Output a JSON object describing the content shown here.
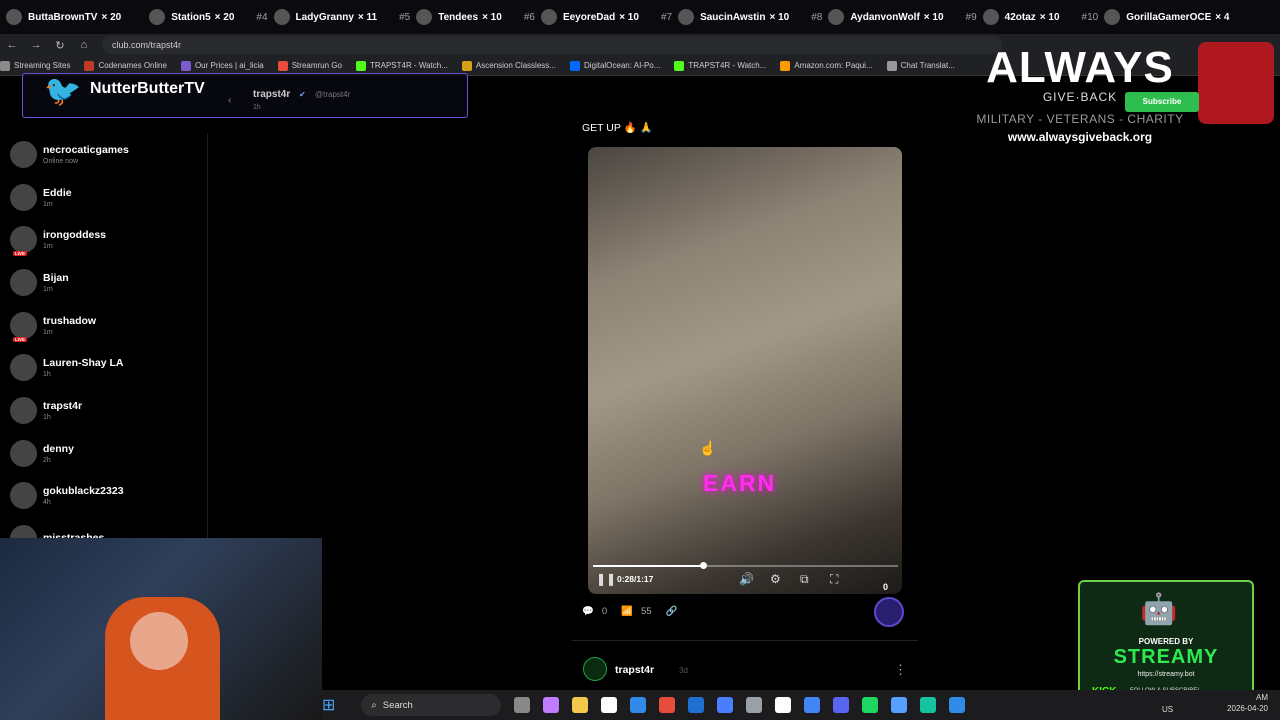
{
  "ticker": [
    {
      "rank": "",
      "name": "ButtaBrownTV",
      "mult": "× 20"
    },
    {
      "rank": "",
      "name": "Station5",
      "mult": "× 20"
    },
    {
      "rank": "#4",
      "name": "LadyGranny",
      "mult": "× 11"
    },
    {
      "rank": "#5",
      "name": "Tendees",
      "mult": "× 10"
    },
    {
      "rank": "#6",
      "name": "EeyoreDad",
      "mult": "× 10"
    },
    {
      "rank": "#7",
      "name": "SaucinAwstin",
      "mult": "× 10"
    },
    {
      "rank": "#8",
      "name": "AydanvonWolf",
      "mult": "× 10"
    },
    {
      "rank": "#9",
      "name": "42otaz",
      "mult": "× 10"
    },
    {
      "rank": "#10",
      "name": "GorillaGamerOCE",
      "mult": "× 4"
    }
  ],
  "browser": {
    "url": "club.com/trapst4r",
    "bookmarks": [
      {
        "label": "Streaming Sites",
        "color": "#8a8a8a"
      },
      {
        "label": "Codenames Online",
        "color": "#c0392b"
      },
      {
        "label": "Our Prices | ai_licia",
        "color": "#7d5ccf"
      },
      {
        "label": "Streamrun Go",
        "color": "#e74c3c"
      },
      {
        "label": "TRAPST4R - Watch...",
        "color": "#53fc18"
      },
      {
        "label": "Ascension Classless...",
        "color": "#d4a017"
      },
      {
        "label": "DigitalOcean: AI-Po...",
        "color": "#0069ff"
      },
      {
        "label": "TRAPST4R - Watch...",
        "color": "#53fc18"
      },
      {
        "label": "Amazon.com: Paqui...",
        "color": "#ff9900"
      },
      {
        "label": "Chat Translat...",
        "color": "#999999"
      }
    ]
  },
  "popup": {
    "twitter_name": "NutterButterTV",
    "poster": "trapst4r",
    "handle": "@trapst4r",
    "time": "1h"
  },
  "sidebar": {
    "items": [
      {
        "name": "necrocaticgames",
        "time": "Online now",
        "live": false
      },
      {
        "name": "Eddie",
        "time": "1m",
        "live": false
      },
      {
        "name": "irongoddess",
        "time": "1m",
        "live": true
      },
      {
        "name": "Bijan",
        "time": "1m",
        "live": false
      },
      {
        "name": "trushadow",
        "time": "1m",
        "live": true
      },
      {
        "name": "Lauren-Shay LA",
        "time": "1h",
        "live": false
      },
      {
        "name": "trapst4r",
        "time": "1h",
        "live": false
      },
      {
        "name": "denny",
        "time": "2h",
        "live": false
      },
      {
        "name": "gokublackz2323",
        "time": "4h",
        "live": false
      },
      {
        "name": "misstrashes",
        "time": "",
        "live": false
      }
    ],
    "live_label": "LIVE"
  },
  "post": {
    "caption": "GET UP 🔥 🙏",
    "overlay_text": "EARN",
    "video_time": "0:28/1:17",
    "progress": 0.36,
    "coin_count": "0",
    "comments": "0",
    "views": "55",
    "next_author": "trapst4r",
    "next_time": "3d"
  },
  "overlay": {
    "title": "ALWAYS",
    "sub": "GIVE·BACK",
    "tagline": "MILITARY - VETERANS - CHARITY",
    "url": "www.alwaysgiveback.org",
    "subscribe": "Subscribe"
  },
  "streamy": {
    "powered": "POWERED BY",
    "name": "STREAMY",
    "url": "https://streamy.bot",
    "kick": "KICK",
    "follow": "FOLLOW & SUBSCRIBE!"
  },
  "taskbar": {
    "search": "Search",
    "lang": "US",
    "time": "AM",
    "date": "2026-04-20",
    "icon_colors": [
      "#888",
      "#c07cff",
      "#f2c94c",
      "#ffffff",
      "#2f8ae8",
      "#e74c3c",
      "#1f6fd1",
      "#4a7dff",
      "#9aa0a6",
      "#ffffff",
      "#4285f4",
      "#5865f2",
      "#1ed760",
      "#58a0ff",
      "#16c3a0",
      "#2f8ae8"
    ]
  }
}
